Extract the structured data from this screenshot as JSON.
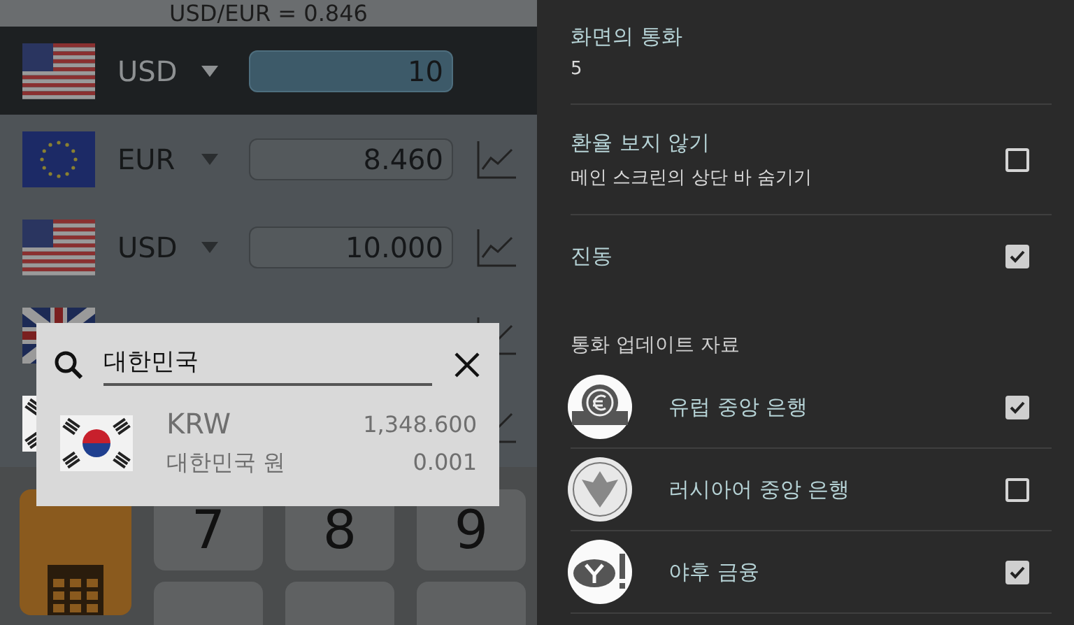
{
  "converter": {
    "rate_bar": "USD/EUR = 0.846",
    "rows": [
      {
        "code": "USD",
        "value": "10",
        "selected": true,
        "chart": false
      },
      {
        "code": "EUR",
        "value": "8.460",
        "selected": false,
        "chart": true
      },
      {
        "code": "USD",
        "value": "10.000",
        "selected": false,
        "chart": true
      },
      {
        "selected": false,
        "chart": true
      },
      {
        "selected": false,
        "chart": true
      }
    ],
    "keys": [
      "7",
      "8",
      "9"
    ]
  },
  "search_dialog": {
    "query": "대한민국",
    "results": [
      {
        "code": "KRW",
        "name": "대한민국 원",
        "rate": "1,348.600",
        "inverse": "0.001"
      }
    ]
  },
  "settings": [
    {
      "kind": "value",
      "title": "화면의 통화",
      "summary": "5"
    },
    {
      "kind": "checkbox",
      "title": "환율 보지 않기",
      "summary": "메인 스크린의 상단 바 숨기기",
      "checked": false
    },
    {
      "kind": "checkbox",
      "title": "진동",
      "checked": true
    },
    {
      "kind": "header",
      "title": "통화 업데이트 자료"
    },
    {
      "kind": "source",
      "title": "유럽 중앙 은행",
      "checked": true
    },
    {
      "kind": "source",
      "title": "러시아어 중앙 은행",
      "checked": false
    },
    {
      "kind": "source",
      "title": "야후 금융",
      "checked": true
    }
  ]
}
